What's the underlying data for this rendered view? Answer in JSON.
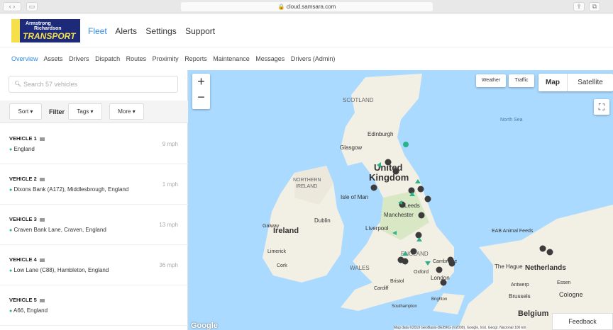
{
  "browser": {
    "url": "cloud.samsara.com"
  },
  "logo": {
    "line1": "Armstrong",
    "line2": "Richardson",
    "line3": "TRANSPORT"
  },
  "topnav": [
    "Fleet",
    "Alerts",
    "Settings",
    "Support"
  ],
  "subnav": [
    "Overview",
    "Assets",
    "Drivers",
    "Dispatch",
    "Routes",
    "Proximity",
    "Reports",
    "Maintenance",
    "Messages",
    "Drivers (Admin)"
  ],
  "sidebar": {
    "search_placeholder": "Search 57 vehicles",
    "sort": "Sort",
    "filter": "Filter",
    "tags": "Tags",
    "more": "More",
    "vehicles": [
      {
        "name": "VEHICLE 1",
        "location": "England",
        "speed": "9 mph"
      },
      {
        "name": "VEHICLE 2",
        "location": "Dixons Bank (A172), Middlesbrough, England",
        "speed": "1 mph"
      },
      {
        "name": "VEHICLE 3",
        "location": "Craven Bank Lane, Craven, England",
        "speed": "13 mph"
      },
      {
        "name": "VEHICLE 4",
        "location": "Low Lane (C88), Hambleton, England",
        "speed": "36 mph"
      },
      {
        "name": "VEHICLE 5",
        "location": "A66, England",
        "speed": ""
      }
    ]
  },
  "map": {
    "weather": "Weather",
    "traffic": "Traffic",
    "map": "Map",
    "satellite": "Satellite",
    "zoom_in": "+",
    "zoom_out": "−",
    "labels": {
      "scotland": "SCOTLAND",
      "edinburgh": "Edinburgh",
      "glasgow": "Glasgow",
      "uk1": "United",
      "uk2": "Kingdom",
      "northern_ireland1": "NORTHERN",
      "northern_ireland2": "IRELAND",
      "isle_of_man": "Isle of Man",
      "ireland": "Ireland",
      "dublin": "Dublin",
      "galway": "Galway",
      "limerick": "Limerick",
      "cork": "Cork",
      "leeds": "Leeds",
      "manchester": "Manchester",
      "liverpool": "Liverpool",
      "england": "ENGLAND",
      "wales": "WALES",
      "cambridge": "Cambridge",
      "oxford": "Oxford",
      "london": "London",
      "cardiff": "Cardiff",
      "bristol": "Bristol",
      "southampton": "Southampton",
      "brighton": "Brighton",
      "north_sea": "North Sea",
      "the_hague": "The Hague",
      "netherlands": "Netherlands",
      "antwerp": "Antwerp",
      "brussels": "Brussels",
      "belgium": "Belgium",
      "essen": "Essen",
      "cologne": "Cologne",
      "eab": "EAB Animal Feeds"
    },
    "attribution": "Map data ©2019 GeoBasis-DE/BKG (©2009), Google, Inst. Geogr. Nacional   100 km",
    "google": "Google",
    "feedback": "Feedback",
    "colors": {
      "sea": "#aadaff",
      "land": "#f2efe4",
      "vehicle_stopped": "#3c3c3c",
      "vehicle_moving": "#2ab38a"
    }
  }
}
